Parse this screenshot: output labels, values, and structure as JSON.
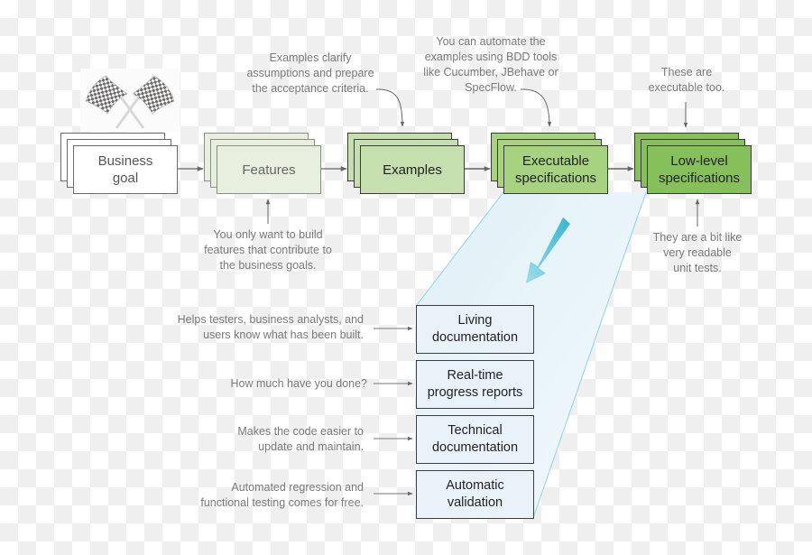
{
  "pipeline": {
    "stages": [
      {
        "id": "business-goal",
        "label": "Business\ngoal",
        "style": "white"
      },
      {
        "id": "features",
        "label": "Features",
        "style": "pale"
      },
      {
        "id": "examples",
        "label": "Examples",
        "style": "light"
      },
      {
        "id": "executable-specifications",
        "label": "Executable\nspecifications",
        "style": "mid"
      },
      {
        "id": "low-level-specifications",
        "label": "Low-level\nspecifications",
        "style": "bright"
      }
    ],
    "flags_icon": "checkered-flags-icon"
  },
  "annotations": {
    "examples_note": "Examples clarify\nassumptions and prepare\nthe acceptance criteria.",
    "automation_note": "You can automate the\nexamples using BDD tools\nlike Cucumber, JBehave or\nSpecFlow.",
    "executable_too_note": "These are\nexecutable too.",
    "features_note": "You only want to build\nfeatures that contribute to\nthe business goals.",
    "unit_tests_note": "They are a bit like\nvery readable\nunit tests."
  },
  "outputs": [
    {
      "label": "Living\ndocumentation",
      "note": "Helps testers, business analysts, and\nusers know what has been built."
    },
    {
      "label": "Real-time\nprogress reports",
      "note": "How much have you done?"
    },
    {
      "label": "Technical\ndocumentation",
      "note": "Makes the code easier to\nupdate and maintain."
    },
    {
      "label": "Automatic\nvalidation",
      "note": "Automated regression and\nfunctional testing comes for free."
    }
  ],
  "colors": {
    "checker_light": "#ffffff",
    "checker_dark": "#efefef",
    "funnel_fill": "#e3f1f8",
    "funnel_edge": "#8fd3e6",
    "big_arrow": "#3db8d0",
    "connector": "#555555",
    "note_text": "#7a7a7a"
  }
}
